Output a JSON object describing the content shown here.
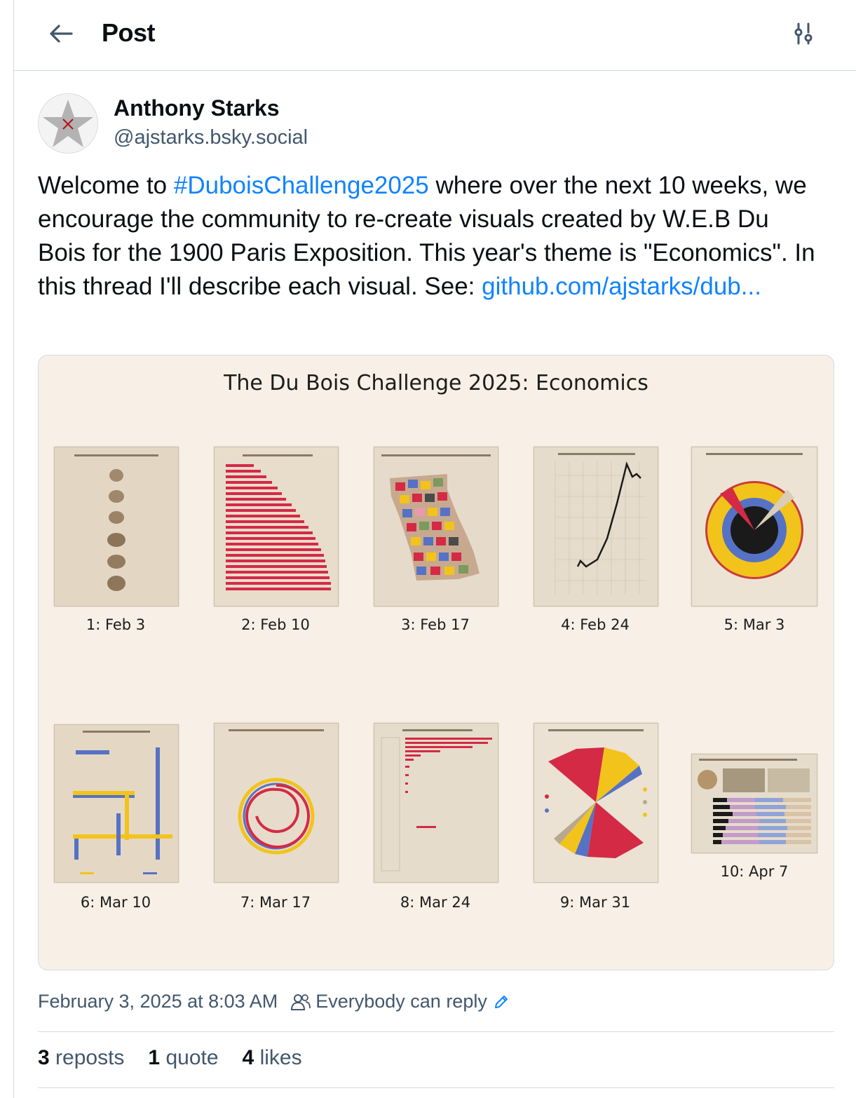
{
  "header": {
    "title": "Post"
  },
  "author": {
    "name": "Anthony Starks",
    "handle": "@ajstarks.bsky.social"
  },
  "post": {
    "text_before": "Welcome to ",
    "hashtag": "#DuboisChallenge2025",
    "text_middle": " where over the next 10 weeks, we encourage the community to re-create  visuals created by W.E.B Du Bois for the 1900 Paris Exposition. This year's theme is \"Economics\".  In this thread I'll describe each visual.  See: ",
    "link": "github.com/ajstarks/dub..."
  },
  "embed": {
    "title": "The Du Bois Challenge 2025: Economics",
    "captions": [
      "1: Feb 3",
      "2: Feb 10",
      "3: Feb 17",
      "4: Feb 24",
      "5: Mar 3",
      "6: Mar 10",
      "7: Mar 17",
      "8: Mar 24",
      "9: Mar 31",
      "10: Apr 7"
    ]
  },
  "meta": {
    "timestamp": "February 3, 2025 at 8:03 AM",
    "reply_setting": "Everybody can reply"
  },
  "stats": {
    "reposts_count": "3",
    "reposts_label": "reposts",
    "quotes_count": "1",
    "quotes_label": "quote",
    "likes_count": "4",
    "likes_label": "likes"
  },
  "colors": {
    "accent": "#1083fe",
    "muted": "#42576c",
    "embed_bg": "#f8efe6",
    "dubois_red": "#d42a45",
    "dubois_yellow": "#f2c31b",
    "dubois_blue": "#5672c4"
  },
  "icons": {
    "back": "arrow-left-icon",
    "settings": "sliders-icon",
    "people": "people-icon",
    "edit": "pencil-icon"
  }
}
